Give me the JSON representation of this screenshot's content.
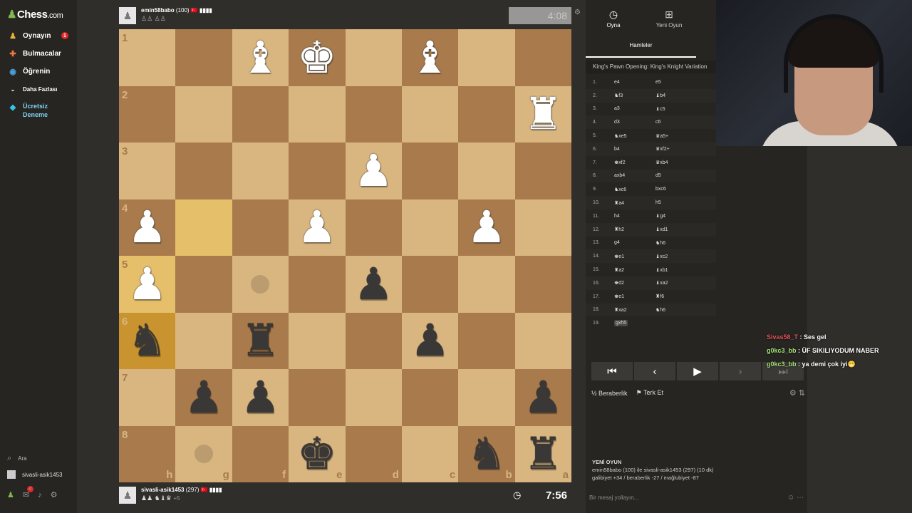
{
  "sidebar": {
    "logo_text": "Chess",
    "logo_suffix": ".com",
    "items": [
      {
        "label": "Oynayın",
        "icon": "play-icon",
        "badge": "1"
      },
      {
        "label": "Bulmacalar",
        "icon": "puzzle-icon"
      },
      {
        "label": "Öğrenin",
        "icon": "learn-icon"
      },
      {
        "label": "Daha Fazlası",
        "icon": "chevron-down-icon"
      }
    ],
    "trial_line1": "Ücretsiz",
    "trial_line2": "Deneme",
    "search_label": "Ara",
    "user_label": "sivasli-asik1453",
    "notif_badge": "4"
  },
  "top_player": {
    "name": "emin58babo",
    "rating": "(100)",
    "flag": "🇹🇷",
    "signal": "▮▮▮▮",
    "clock": "4:08"
  },
  "bottom_player": {
    "name": "sivasli-asik1453",
    "rating": "(297)",
    "flag": "🇹🇷",
    "signal": "▮▮▮▮",
    "captured": "♟♟ ♞♝♛",
    "captured_plus": "+5",
    "clock": "7:56"
  },
  "board": {
    "ranks": [
      "1",
      "2",
      "3",
      "4",
      "5",
      "6",
      "7",
      "8"
    ],
    "files": [
      "h",
      "g",
      "f",
      "e",
      "d",
      "c",
      "b",
      "a"
    ]
  },
  "panel": {
    "tab_play": "Oyna",
    "tab_new": "Yeni Oyun",
    "tab_moves": "Hamleler",
    "opening": "King's Pawn Opening: King's Knight Variation",
    "moves": [
      {
        "n": "1.",
        "w": "e4",
        "b": "e5",
        "bar": 0
      },
      {
        "n": "2.",
        "w": "♞f3",
        "b": "♝b4",
        "bar": 0
      },
      {
        "n": "3.",
        "w": "a3",
        "b": "♝c5",
        "bar": 0
      },
      {
        "n": "4.",
        "w": "d3",
        "b": "c6",
        "bar": 0
      },
      {
        "n": "5.",
        "w": "♞xe5",
        "b": "♛a5+",
        "bar": 0
      },
      {
        "n": "6.",
        "w": "b4",
        "b": "♛xf2+",
        "bar": 0
      },
      {
        "n": "7.",
        "w": "♚xf2",
        "b": "♛xb4",
        "bar": 0.4
      },
      {
        "n": "8.",
        "w": "axb4",
        "b": "d5",
        "bar": 0.3
      },
      {
        "n": "9.",
        "w": "♞xc6",
        "b": "bxc6",
        "bar": 0.35
      },
      {
        "n": "10.",
        "w": "♜a4",
        "b": "h5",
        "bar": 0.3
      },
      {
        "n": "11.",
        "w": "h4",
        "b": "♝g4",
        "bar": 0.3
      },
      {
        "n": "12.",
        "w": "♜h2",
        "b": "♝xd1",
        "bar": 0.5
      },
      {
        "n": "13.",
        "w": "g4",
        "b": "♞h6",
        "bar": 0.45
      },
      {
        "n": "14.",
        "w": "♚e1",
        "b": "♝xc2",
        "bar": 0.4
      },
      {
        "n": "15.",
        "w": "♜a2",
        "b": "♝xb1",
        "bar": 0.35
      },
      {
        "n": "16.",
        "w": "♚d2",
        "b": "♝xa2",
        "bar": 0.45
      },
      {
        "n": "17.",
        "w": "♚e1",
        "b": "♜f6",
        "bar": 0.4
      },
      {
        "n": "18.",
        "w": "♜xa2",
        "b": "♞h6",
        "bar": 0.45
      },
      {
        "n": "19.",
        "w": "gxh5",
        "b": "",
        "bar": 0.5
      }
    ],
    "draw_label": "Beraberlik",
    "resign_label": "Terk Et",
    "newgame_title": "YENİ OYUN",
    "newgame_line1": "emin58babo (100) ile sivasli-asik1453 (297) (10 dk)",
    "newgame_line2": "galibiyet +34 / beraberlik -27 / mağlubiyet -87",
    "message_placeholder": "Bir mesaj yollayın..."
  },
  "chat": [
    {
      "user": "Sivas58_T",
      "text": ": Ses gel",
      "color": "#e0555b"
    },
    {
      "user": "g0kc3_bb",
      "text": ": ÜF SIKILIYODUM NABER",
      "color": "#a8e27a"
    },
    {
      "user": "g0kc3_bb",
      "text": ": ya demi çok iyi😁",
      "color": "#a8e27a"
    }
  ],
  "colors": {
    "light_square": "#d9b680",
    "dark_square": "#a87a4c",
    "highlight": "#c9932f",
    "accent_green": "#81b64c"
  }
}
